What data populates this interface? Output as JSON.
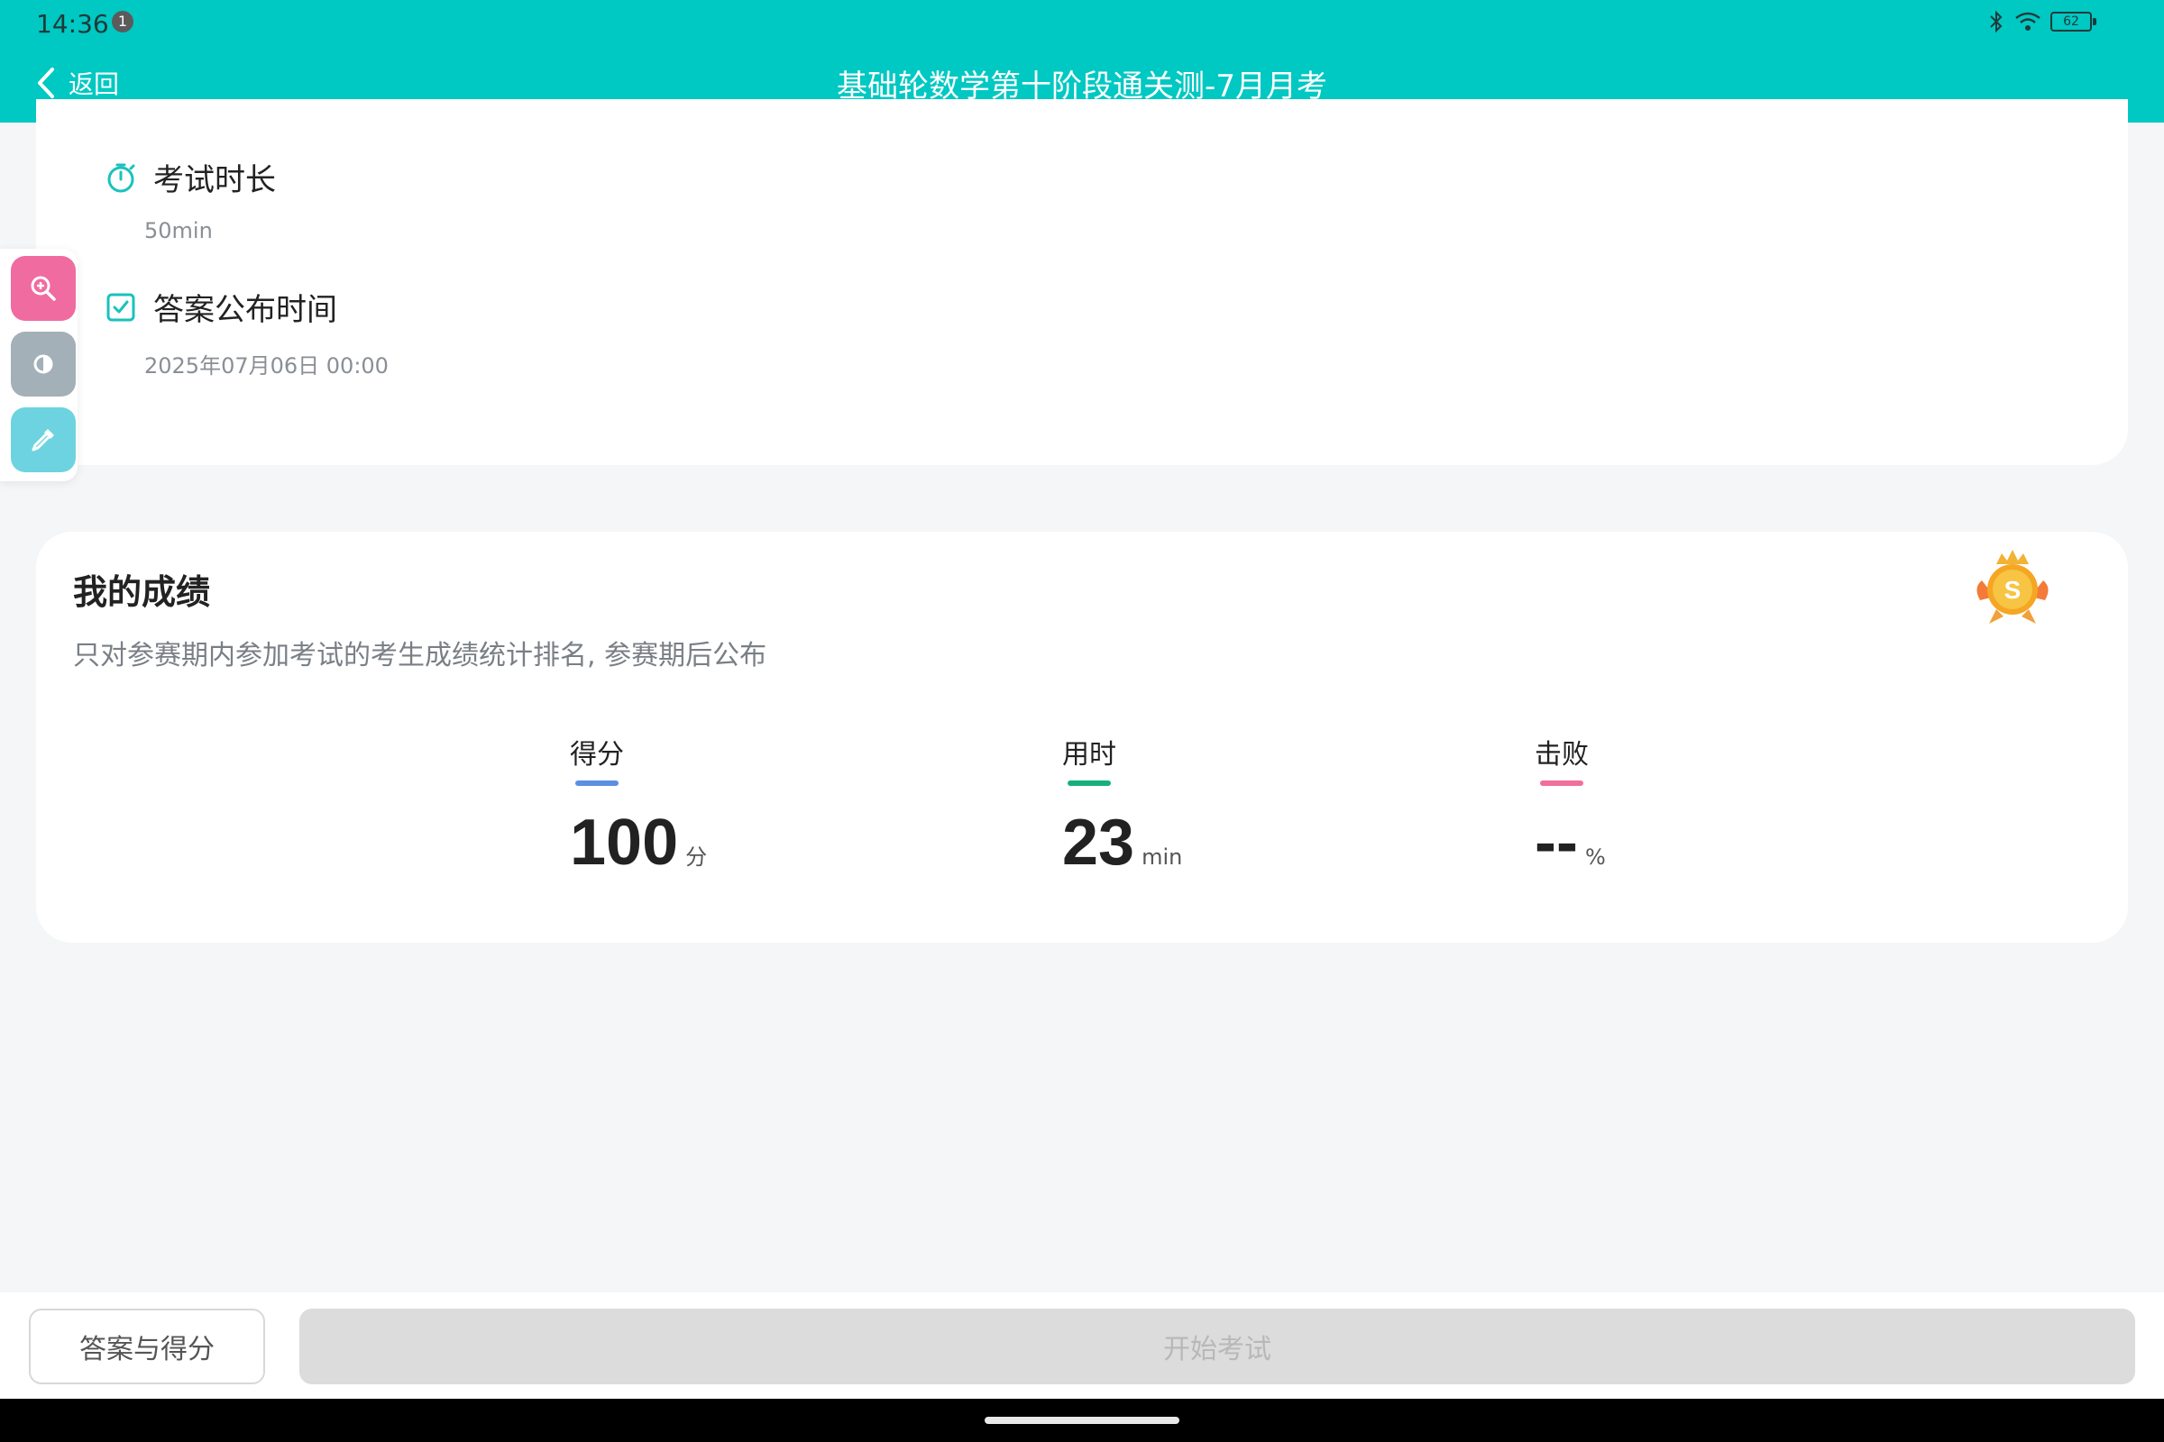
{
  "status_bar": {
    "time": "14:36",
    "notification_count": "1",
    "battery": "62"
  },
  "header": {
    "back_label": "返回",
    "title": "基础轮数学第十阶段通关测-7月月考"
  },
  "exam_info": {
    "duration_title": "考试时长",
    "duration_value": "50min",
    "publish_title": "答案公布时间",
    "publish_value": "2025年07月06日 00:00"
  },
  "score_card": {
    "title": "我的成绩",
    "subtitle": "只对参赛期内参加考试的考生成绩统计排名, 参赛期后公布",
    "badge_letter": "S",
    "stats": [
      {
        "label": "得分",
        "value": "100",
        "unit": "分",
        "color": "#5b8fe0"
      },
      {
        "label": "用时",
        "value": "23",
        "unit": "min",
        "color": "#16b07c"
      },
      {
        "label": "击败",
        "value": "--",
        "unit": "%",
        "color": "#f0709a"
      }
    ]
  },
  "tools": [
    {
      "name": "zoom-icon",
      "color": "#f06ba0"
    },
    {
      "name": "contrast-icon",
      "color": "#a3b0b8"
    },
    {
      "name": "eyedropper-icon",
      "color": "#6dd3e0"
    }
  ],
  "bottom": {
    "answers_label": "答案与得分",
    "start_label": "开始考试"
  }
}
